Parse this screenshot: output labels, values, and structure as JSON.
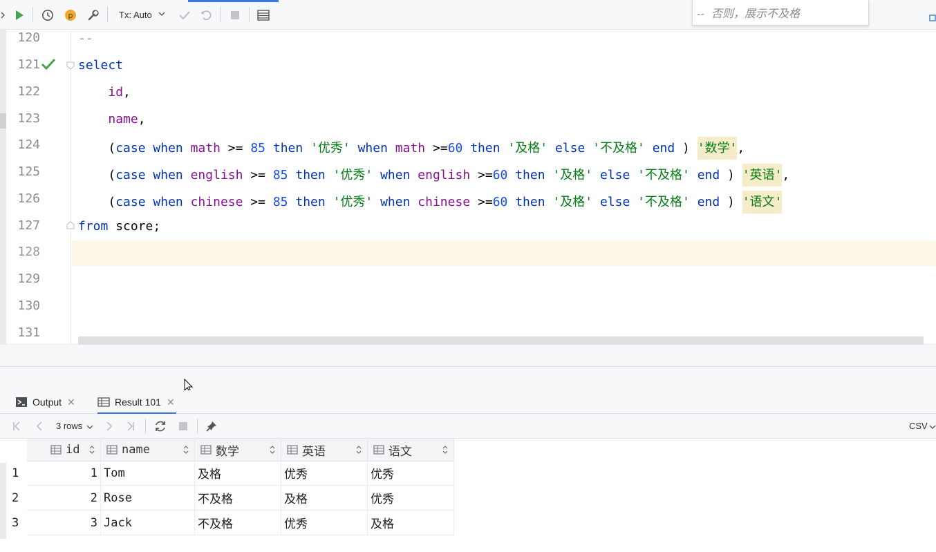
{
  "toolbar": {
    "tx_mode": "Tx: Auto",
    "hint": "--  否则，展示不及格"
  },
  "editor": {
    "lines": [
      {
        "no": "120"
      },
      {
        "no": "121"
      },
      {
        "no": "122"
      },
      {
        "no": "123"
      },
      {
        "no": "124"
      },
      {
        "no": "125"
      },
      {
        "no": "126"
      },
      {
        "no": "127"
      },
      {
        "no": "128"
      },
      {
        "no": "129"
      },
      {
        "no": "130"
      },
      {
        "no": "131"
      }
    ],
    "code": {
      "l120": "--",
      "l121_kw": "select",
      "l122": "id",
      "l123": "name",
      "case_kw": "case",
      "when_kw": "when",
      "then_kw": "then",
      "else_kw": "else",
      "end_kw": "end",
      "col_math": "math",
      "col_english": "english",
      "col_chinese": "chinese",
      "op_ge": ">=",
      "num_85": "85",
      "num_60": "60",
      "str_excellent": "'优秀'",
      "str_pass": "'及格'",
      "str_fail": "'不及格'",
      "alias_math": "'数学'",
      "alias_english": "'英语'",
      "alias_chinese": "'语文'",
      "l127_kw": "from",
      "l127_table": "score;"
    }
  },
  "results": {
    "tabs": [
      {
        "label": "Output"
      },
      {
        "label": "Result 101"
      }
    ],
    "rows_label": "3 rows",
    "format_label": "CSV",
    "columns": [
      "id",
      "name",
      "数学",
      "英语",
      "语文"
    ],
    "rows": [
      {
        "n": "1",
        "id": "1",
        "name": "Tom",
        "math": "及格",
        "english": "优秀",
        "chinese": "优秀"
      },
      {
        "n": "2",
        "id": "2",
        "name": "Rose",
        "math": "不及格",
        "english": "及格",
        "chinese": "优秀"
      },
      {
        "n": "3",
        "id": "3",
        "name": "Jack",
        "math": "不及格",
        "english": "优秀",
        "chinese": "及格"
      }
    ]
  }
}
